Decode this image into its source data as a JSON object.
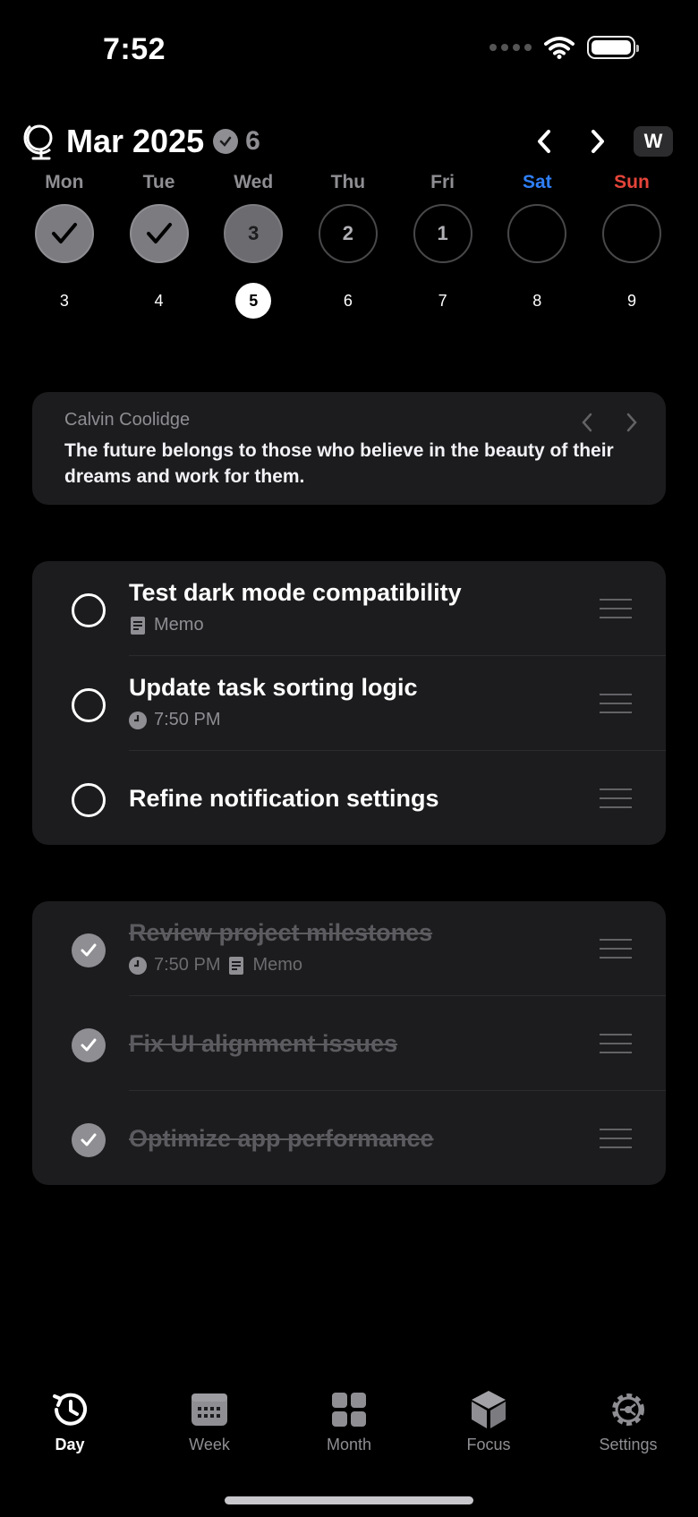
{
  "status_bar": {
    "time": "7:52"
  },
  "header": {
    "month": "Mar 2025",
    "count": "6",
    "week_toggle": "W"
  },
  "week": [
    {
      "name": "Mon",
      "ring": "",
      "date": "3",
      "state": "done"
    },
    {
      "name": "Tue",
      "ring": "",
      "date": "4",
      "state": "done"
    },
    {
      "name": "Wed",
      "ring": "3",
      "date": "5",
      "state": "partial",
      "today": true
    },
    {
      "name": "Thu",
      "ring": "2",
      "date": "6",
      "state": "open"
    },
    {
      "name": "Fri",
      "ring": "1",
      "date": "7",
      "state": "open"
    },
    {
      "name": "Sat",
      "ring": "",
      "date": "8",
      "state": "empty"
    },
    {
      "name": "Sun",
      "ring": "",
      "date": "9",
      "state": "empty"
    }
  ],
  "quote": {
    "author": "Calvin Coolidge",
    "text": "The future belongs to those who believe in the beauty of their dreams and work for them."
  },
  "open_tasks": [
    {
      "title": "Test dark mode compatibility",
      "memo": "Memo"
    },
    {
      "title": "Update task sorting logic",
      "time": "7:50 PM"
    },
    {
      "title": "Refine notification settings"
    }
  ],
  "done_tasks": [
    {
      "title": "Review project milestones",
      "time": "7:50 PM",
      "memo": "Memo"
    },
    {
      "title": "Fix UI alignment issues"
    },
    {
      "title": "Optimize app performance"
    }
  ],
  "tabs": [
    {
      "label": "Day",
      "icon": "clock-history-icon",
      "active": true
    },
    {
      "label": "Week",
      "icon": "calendar-week-icon"
    },
    {
      "label": "Month",
      "icon": "grid-icon"
    },
    {
      "label": "Focus",
      "icon": "cube-icon"
    },
    {
      "label": "Settings",
      "icon": "gear-icon"
    }
  ],
  "colors": {
    "background": "#000000",
    "card": "#1c1c1e",
    "saturday": "#2f7ff6",
    "sunday": "#e5453a",
    "muted": "#8e8e93"
  }
}
